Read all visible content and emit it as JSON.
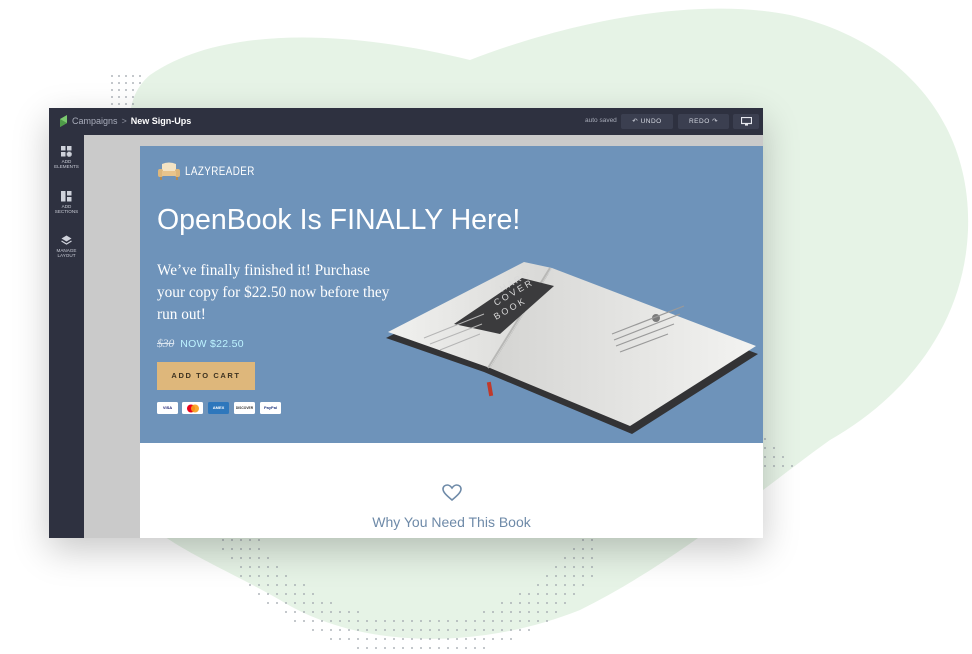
{
  "topbar": {
    "breadcrumb_parent": "Campaigns",
    "breadcrumb_separator": ">",
    "breadcrumb_current": "New Sign-Ups",
    "autosave_status": "auto saved",
    "undo_label": "UNDO",
    "redo_label": "REDO",
    "preview_icon": "monitor-icon"
  },
  "sidebar": {
    "items": [
      {
        "line1": "ADD",
        "line2": "ELEMENTS",
        "icon": "add-elements-icon"
      },
      {
        "line1": "ADD",
        "line2": "SECTIONS",
        "icon": "add-sections-icon"
      },
      {
        "line1": "MANAGE",
        "line2": "LAYOUT",
        "icon": "layers-icon"
      }
    ]
  },
  "page": {
    "brand_name": "LAZYREADER",
    "headline": "OpenBook Is FINALLY Here!",
    "subcopy": "We’ve finally finished it! Purchase your copy for $22.50 now before they run out!",
    "old_price": "$30",
    "now_price": "NOW $22.50",
    "cart_button": "ADD TO CART",
    "payment_cards": [
      "VISA",
      "mastercard",
      "AMEX",
      "DISCOVER",
      "PayPal"
    ],
    "section_heading": "Why You Need This Book"
  },
  "colors": {
    "topbar_bg": "#2e3140",
    "hero_bg": "#6e93ba",
    "cart_button": "#deb77b",
    "now_price": "#bdf3ff",
    "section_heading": "#6e8aa8",
    "blob": "#e6f3e6"
  }
}
